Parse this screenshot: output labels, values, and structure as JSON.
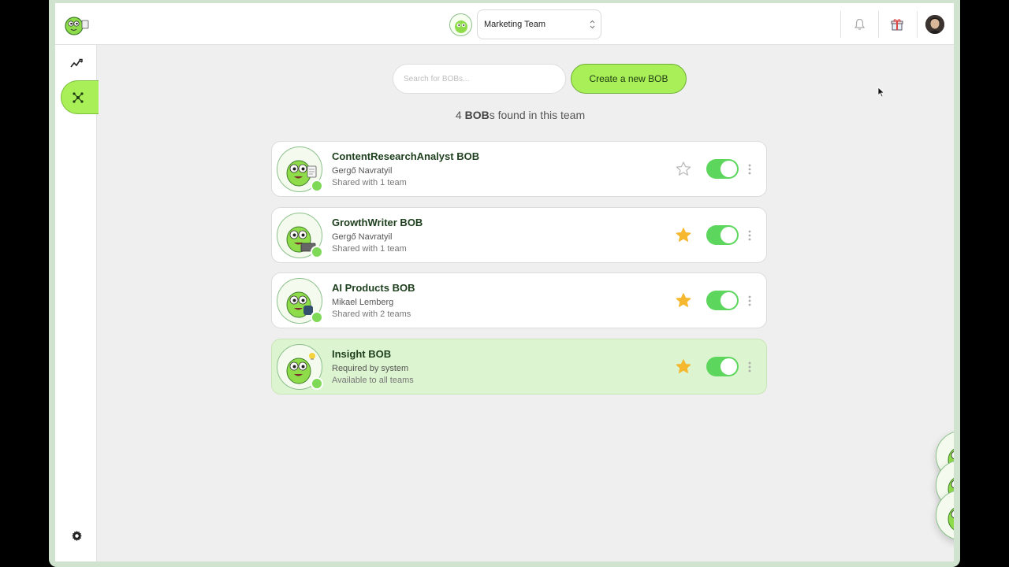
{
  "header": {
    "team_select_value": "Marketing Team",
    "icons": [
      "bell-icon",
      "gift-icon"
    ]
  },
  "sidebar": {
    "items": [
      {
        "name": "analytics",
        "icon": "trending-up-icon"
      },
      {
        "name": "bobs",
        "icon": "network-icon",
        "active": true
      },
      {
        "name": "settings",
        "icon": "gear-icon"
      }
    ]
  },
  "search": {
    "placeholder": "Search for BOBs..."
  },
  "create_button_label": "Create a new BOB",
  "count": {
    "number": "4",
    "entity": "BOB",
    "suffix": "s found in this team"
  },
  "bobs": [
    {
      "name": "ContentResearchAnalyst BOB",
      "owner": "Gergő Navratyil",
      "sharing": "Shared with 1 team",
      "favorite": false,
      "enabled": true
    },
    {
      "name": "GrowthWriter BOB",
      "owner": "Gergő Navratyil",
      "sharing": "Shared with 1 team",
      "favorite": true,
      "enabled": true
    },
    {
      "name": "AI Products BOB",
      "owner": "Mikael Lemberg",
      "sharing": "Shared with 2 teams",
      "favorite": true,
      "enabled": true
    },
    {
      "name": "Insight BOB",
      "owner": "Required by system",
      "sharing": "Available to all teams",
      "favorite": true,
      "enabled": true,
      "system": true
    }
  ],
  "colors": {
    "accent": "#a8ef58",
    "toggle_on": "#5cd65c",
    "star": "#f5b82e",
    "system_card": "#ddf4d0"
  }
}
